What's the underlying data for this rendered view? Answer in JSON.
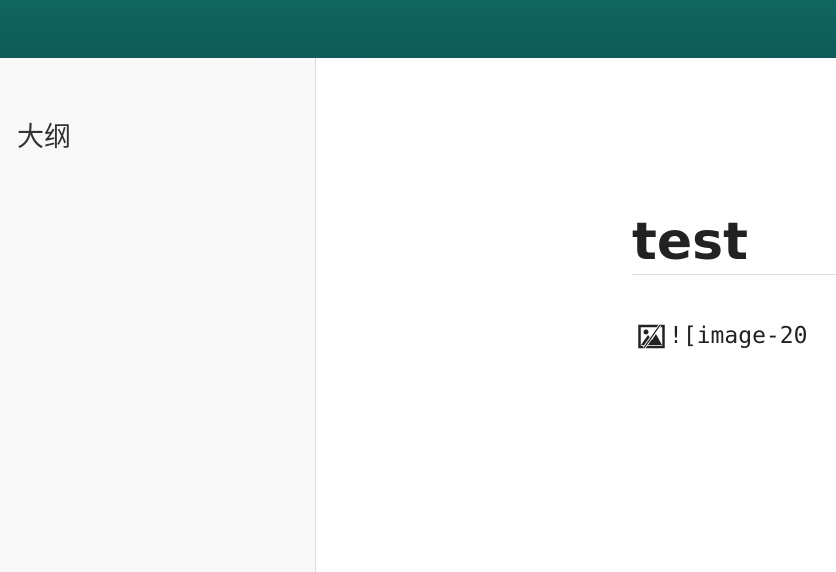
{
  "sidebar": {
    "outline_title": "大纲"
  },
  "document": {
    "title": "test",
    "broken_image_text": "![image-20"
  },
  "icons": {
    "broken_image": "broken-image-icon"
  },
  "colors": {
    "topbar": "#106660",
    "sidebar_bg": "#f8f8f8",
    "text": "#222222"
  }
}
